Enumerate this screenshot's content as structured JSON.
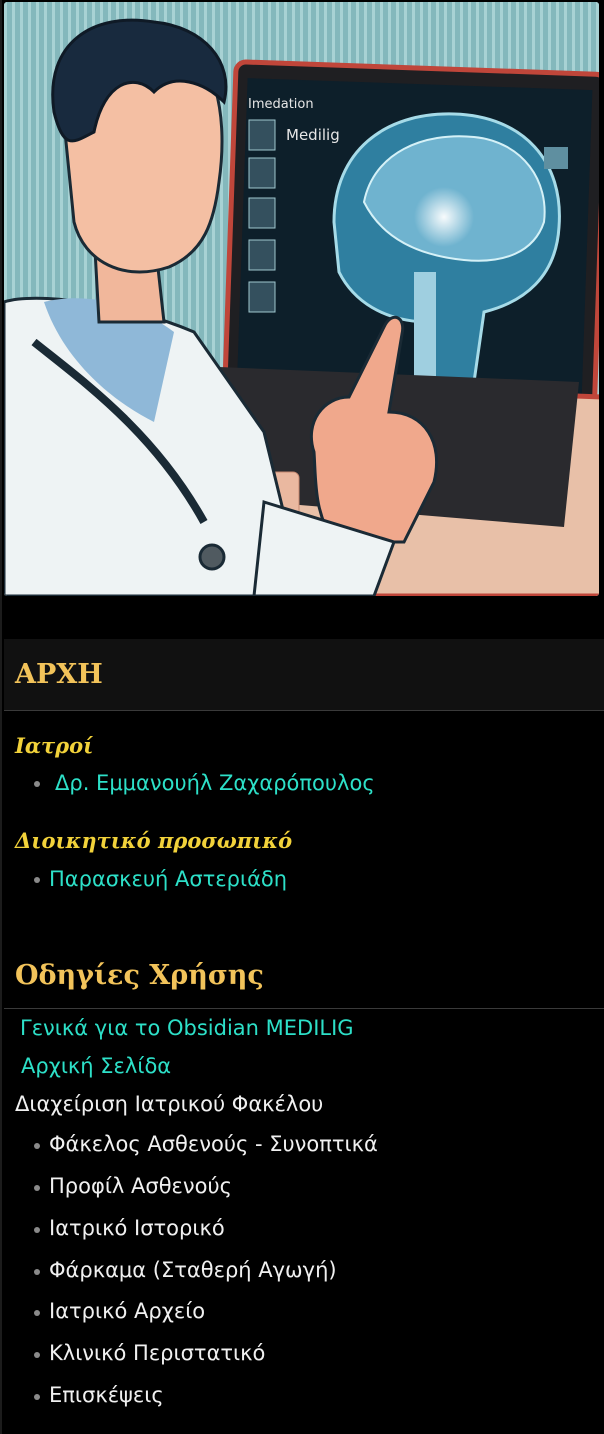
{
  "hero": {
    "screen_texts": [
      "Imedation",
      "Medilig"
    ]
  },
  "home": {
    "title": "ΑΡΧΗ",
    "doctors_heading": "Ιατροί",
    "doctors": [
      "Δρ. Εμμανουήλ Ζαχαρόπουλος"
    ],
    "admin_heading": "Διοικητικό προσωπικό",
    "admin": [
      "Παρασκευή Αστεριάδη"
    ]
  },
  "guide": {
    "title": "Οδηγίες Χρήσης",
    "link_general": "Γενικά για το Obsidian MEDILIG",
    "link_home": "Αρχική Σελίδα",
    "folder_label": "Διαχείριση Ιατρικού Φακέλου",
    "items": [
      "Φάκελος Ασθενούς -   Συνοπτικά",
      "Προφίλ Ασθενούς",
      "Ιατρικό Ιστορικό",
      "Φάρκαμα (Σταθερή Αγωγή)",
      "Ιατρικό Αρχείο",
      "Κλινικό Περιστατικό",
      "Επισκέψεις"
    ]
  }
}
